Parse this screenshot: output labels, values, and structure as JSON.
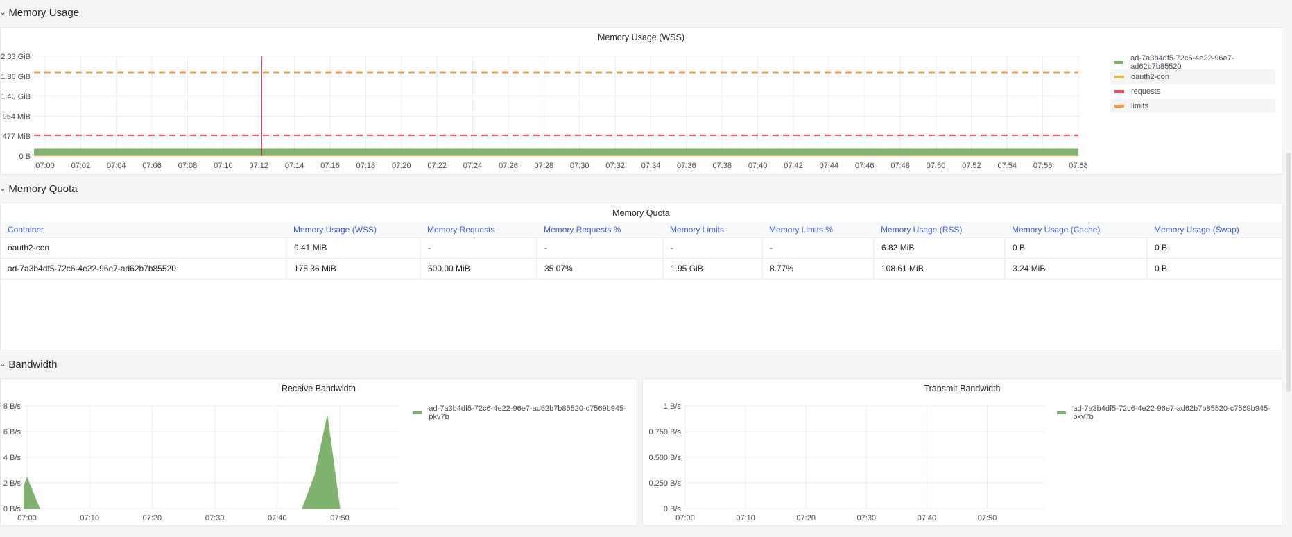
{
  "rows": {
    "memory_usage": "Memory Usage",
    "memory_quota": "Memory Quota",
    "bandwidth": "Bandwidth"
  },
  "colors": {
    "green": "#7eb26d",
    "yellow": "#eab839",
    "red": "#f2495c",
    "orange": "#ff9830",
    "header_blue": "#3d5bd6"
  },
  "icons": {
    "row_toggle": "chevron-down-icon"
  },
  "memory_usage_panel": {
    "title": "Memory Usage (WSS)",
    "legend": [
      {
        "label": "ad-7a3b4df5-72c6-4e22-96e7-ad62b7b85520",
        "color": "#7eb26d"
      },
      {
        "label": "oauth2-con",
        "color": "#eab839"
      },
      {
        "label": "requests",
        "color": "#f2495c"
      },
      {
        "label": "limits",
        "color": "#ff9830"
      }
    ]
  },
  "memory_quota_panel": {
    "title": "Memory Quota",
    "columns": [
      "Container",
      "Memory Usage (WSS)",
      "Memory Requests",
      "Memory Requests %",
      "Memory Limits",
      "Memory Limits %",
      "Memory Usage (RSS)",
      "Memory Usage (Cache)",
      "Memory Usage (Swap)"
    ],
    "rows": [
      [
        "oauth2-con",
        "9.41 MiB",
        "-",
        "-",
        "-",
        "-",
        "6.82 MiB",
        "0 B",
        "0 B"
      ],
      [
        "ad-7a3b4df5-72c6-4e22-96e7-ad62b7b85520",
        "175.36 MiB",
        "500.00 MiB",
        "35.07%",
        "1.95 GiB",
        "8.77%",
        "108.61 MiB",
        "3.24 MiB",
        "0 B"
      ]
    ]
  },
  "receive_panel": {
    "title": "Receive Bandwidth",
    "legend": [
      {
        "label": "ad-7a3b4df5-72c6-4e22-96e7-ad62b7b85520-c7569b945-pkv7b",
        "color": "#7eb26d"
      }
    ]
  },
  "transmit_panel": {
    "title": "Transmit Bandwidth",
    "legend": [
      {
        "label": "ad-7a3b4df5-72c6-4e22-96e7-ad62b7b85520-c7569b945-pkv7b",
        "color": "#7eb26d"
      }
    ]
  },
  "chart_data": [
    {
      "type": "area",
      "title": "Memory Usage (WSS)",
      "yticks": [
        "0 B",
        "477 MiB",
        "954 MiB",
        "1.40 GiB",
        "1.86 GiB",
        "2.33 GiB"
      ],
      "ylim_gib": [
        0,
        2.33
      ],
      "xticks": [
        "07:00",
        "07:02",
        "07:04",
        "07:06",
        "07:08",
        "07:10",
        "07:12",
        "07:14",
        "07:16",
        "07:18",
        "07:20",
        "07:22",
        "07:24",
        "07:26",
        "07:28",
        "07:30",
        "07:32",
        "07:34",
        "07:36",
        "07:38",
        "07:40",
        "07:42",
        "07:44",
        "07:46",
        "07:48",
        "07:50",
        "07:52",
        "07:54",
        "07:56",
        "07:58"
      ],
      "series": [
        {
          "name": "ad-7a3b4df5-72c6-4e22-96e7-ad62b7b85520",
          "value_mib": 175.36,
          "style": "area",
          "color": "#7eb26d"
        },
        {
          "name": "oauth2-con",
          "value_mib": 9.41,
          "style": "line",
          "color": "#eab839"
        },
        {
          "name": "requests",
          "value_mib": 500,
          "style": "dashed",
          "color": "#f2495c"
        },
        {
          "name": "limits",
          "value_mib": 1996.8,
          "style": "dashed",
          "color": "#ff9830"
        }
      ],
      "crosshair_time": "07:12",
      "grid": true,
      "legend": "right"
    },
    {
      "type": "area",
      "title": "Receive Bandwidth",
      "yticks": [
        "0 B/s",
        "2 B/s",
        "4 B/s",
        "6 B/s",
        "8 B/s"
      ],
      "ylim": [
        0,
        8
      ],
      "xticks": [
        "07:00",
        "07:10",
        "07:20",
        "07:30",
        "07:40",
        "07:50"
      ],
      "series": [
        {
          "name": "ad-7a3b4df5-72c6-4e22-96e7-ad62b7b85520-c7569b945-pkv7b",
          "color": "#7eb26d",
          "points": [
            [
              "06:59:30",
              1.7
            ],
            [
              "07:00",
              2.4
            ],
            [
              "07:02",
              0
            ],
            [
              "07:44",
              0
            ],
            [
              "07:46",
              2.6
            ],
            [
              "07:48",
              7.2
            ],
            [
              "07:50",
              0
            ]
          ]
        }
      ],
      "grid": true,
      "legend": "right"
    },
    {
      "type": "area",
      "title": "Transmit Bandwidth",
      "yticks": [
        "0 B/s",
        "0.250 B/s",
        "0.500 B/s",
        "0.750 B/s",
        "1 B/s"
      ],
      "ylim": [
        0,
        1
      ],
      "xticks": [
        "07:00",
        "07:10",
        "07:20",
        "07:30",
        "07:40",
        "07:50"
      ],
      "series": [
        {
          "name": "ad-7a3b4df5-72c6-4e22-96e7-ad62b7b85520-c7569b945-pkv7b",
          "color": "#7eb26d",
          "points": []
        }
      ],
      "grid": true,
      "legend": "right"
    }
  ]
}
